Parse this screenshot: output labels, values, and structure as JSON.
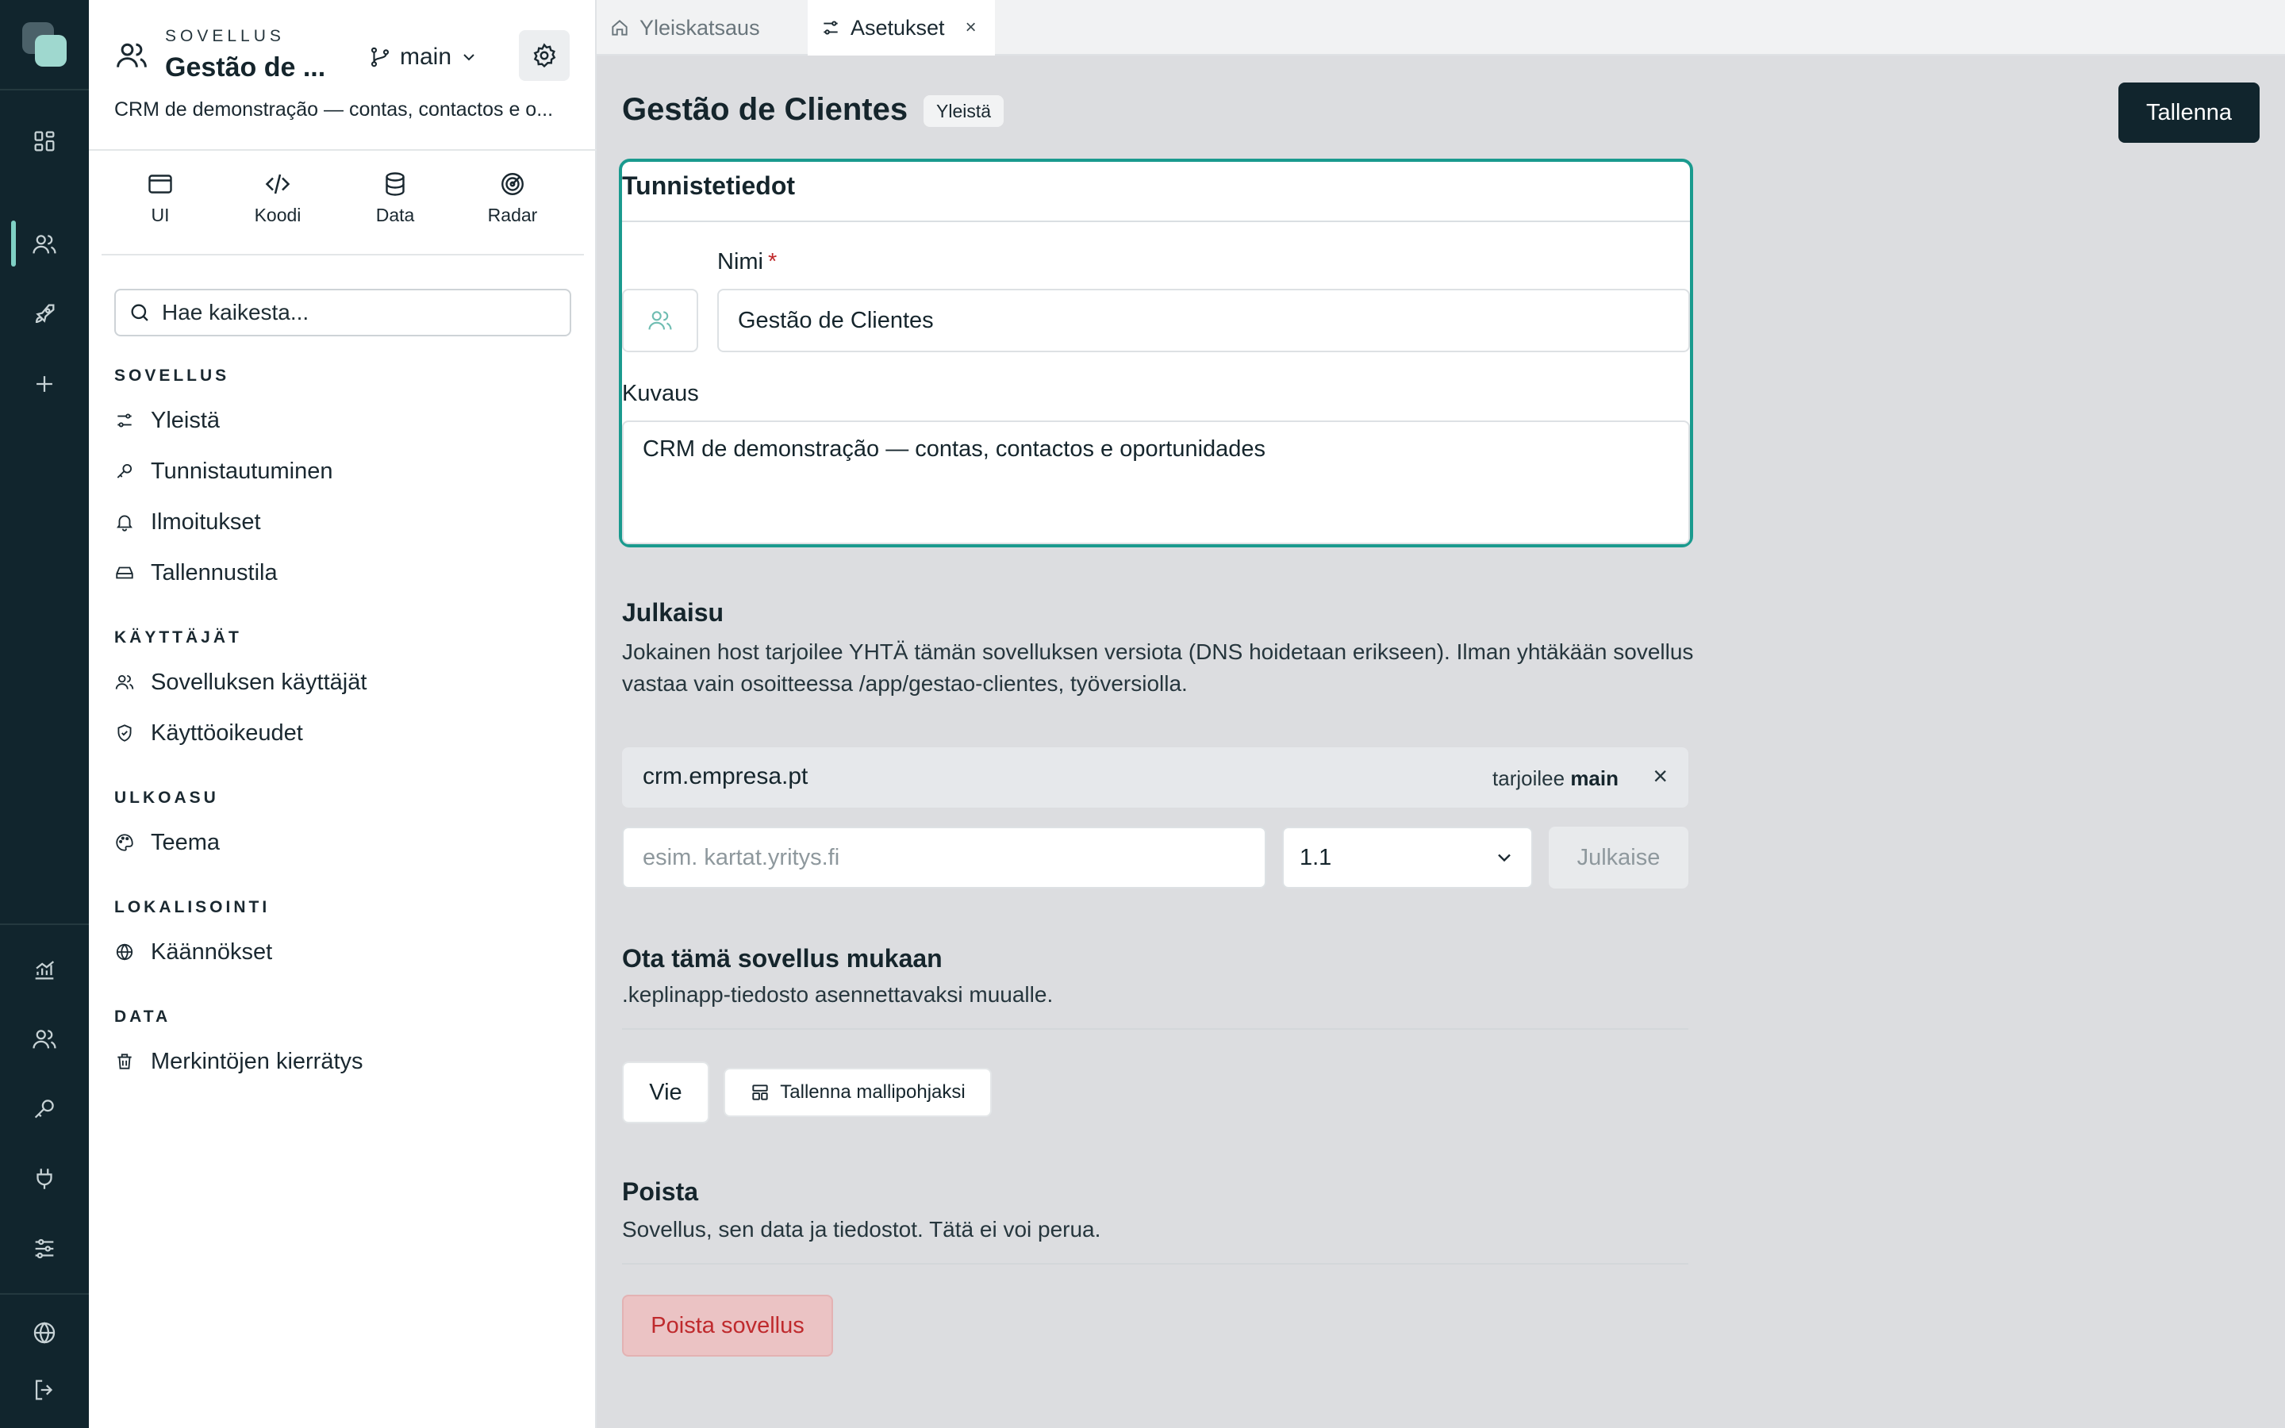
{
  "rail": {
    "top_icons": [
      "dashboard-icon",
      "users-icon",
      "rocket-icon",
      "plus-icon"
    ],
    "bottom_icons": [
      "chart-icon",
      "users-icon",
      "key-icon",
      "plug-icon",
      "sliders-icon",
      "globe-icon",
      "logout-icon"
    ],
    "active_color": "#7fd0c4"
  },
  "sidebar": {
    "kicker": "SOVELLUS",
    "app_name": "Gestão de ...",
    "branch": "main",
    "description": "CRM de demonstração — contas, contactos e o...",
    "modes": [
      {
        "label": "UI",
        "icon": "window-icon"
      },
      {
        "label": "Koodi",
        "icon": "code-icon"
      },
      {
        "label": "Data",
        "icon": "database-icon"
      },
      {
        "label": "Radar",
        "icon": "radar-icon"
      }
    ],
    "search_placeholder": "Hae kaikesta...",
    "sections": [
      {
        "title": "SOVELLUS",
        "items": [
          {
            "label": "Yleistä",
            "icon": "sliders-icon"
          },
          {
            "label": "Tunnistautuminen",
            "icon": "key-icon"
          },
          {
            "label": "Ilmoitukset",
            "icon": "bell-icon"
          },
          {
            "label": "Tallennustila",
            "icon": "storage-icon"
          }
        ]
      },
      {
        "title": "KÄYTTÄJÄT",
        "items": [
          {
            "label": "Sovelluksen käyttäjät",
            "icon": "users-icon"
          },
          {
            "label": "Käyttöoikeudet",
            "icon": "shield-icon"
          }
        ]
      },
      {
        "title": "ULKOASU",
        "items": [
          {
            "label": "Teema",
            "icon": "palette-icon"
          }
        ]
      },
      {
        "title": "LOKALISOINTI",
        "items": [
          {
            "label": "Käännökset",
            "icon": "globe-icon"
          }
        ]
      },
      {
        "title": "DATA",
        "items": [
          {
            "label": "Merkintöjen kierrätys",
            "icon": "trash-icon"
          }
        ]
      }
    ]
  },
  "tabs": [
    {
      "label": "Yleiskatsaus",
      "icon": "home-icon",
      "active": false
    },
    {
      "label": "Asetukset",
      "icon": "sliders-icon",
      "active": true,
      "close": "×"
    }
  ],
  "main": {
    "title": "Gestão de Clientes",
    "badge": "Yleistä",
    "save_label": "Tallenna",
    "identity": {
      "title": "Tunnistetiedot",
      "name_label": "Nimi",
      "required_mark": "*",
      "name_value": "Gestão de Clientes",
      "desc_label": "Kuvaus",
      "desc_value": "CRM de demonstração — contas, contactos e oportunidades",
      "accent": "#1a9a8e"
    },
    "publish": {
      "title": "Julkaisu",
      "text": "Jokainen host tarjoilee YHTÄ tämän sovelluksen versiota (DNS hoidetaan erikseen). Ilman yhtäkään sovellus vastaa vain osoitteessa /app/gestao-clientes, työversiolla.",
      "domains": [
        {
          "host": "crm.empresa.pt",
          "serves_prefix": "tarjoilee",
          "serves_branch": "main",
          "remove": "×"
        }
      ],
      "host_placeholder": "esim. kartat.yritys.fi",
      "version_value": "1.1",
      "publish_label": "Julkaise"
    },
    "export": {
      "title": "Ota tämä sovellus mukaan",
      "text": ".keplinapp-tiedosto asennettavaksi muualle.",
      "export_label": "Vie",
      "template_label": "Tallenna mallipohjaksi"
    },
    "delete": {
      "title": "Poista",
      "text": "Sovellus, sen data ja tiedostot. Tätä ei voi perua.",
      "button_label": "Poista sovellus",
      "danger_color": "#bf2a2d"
    }
  }
}
